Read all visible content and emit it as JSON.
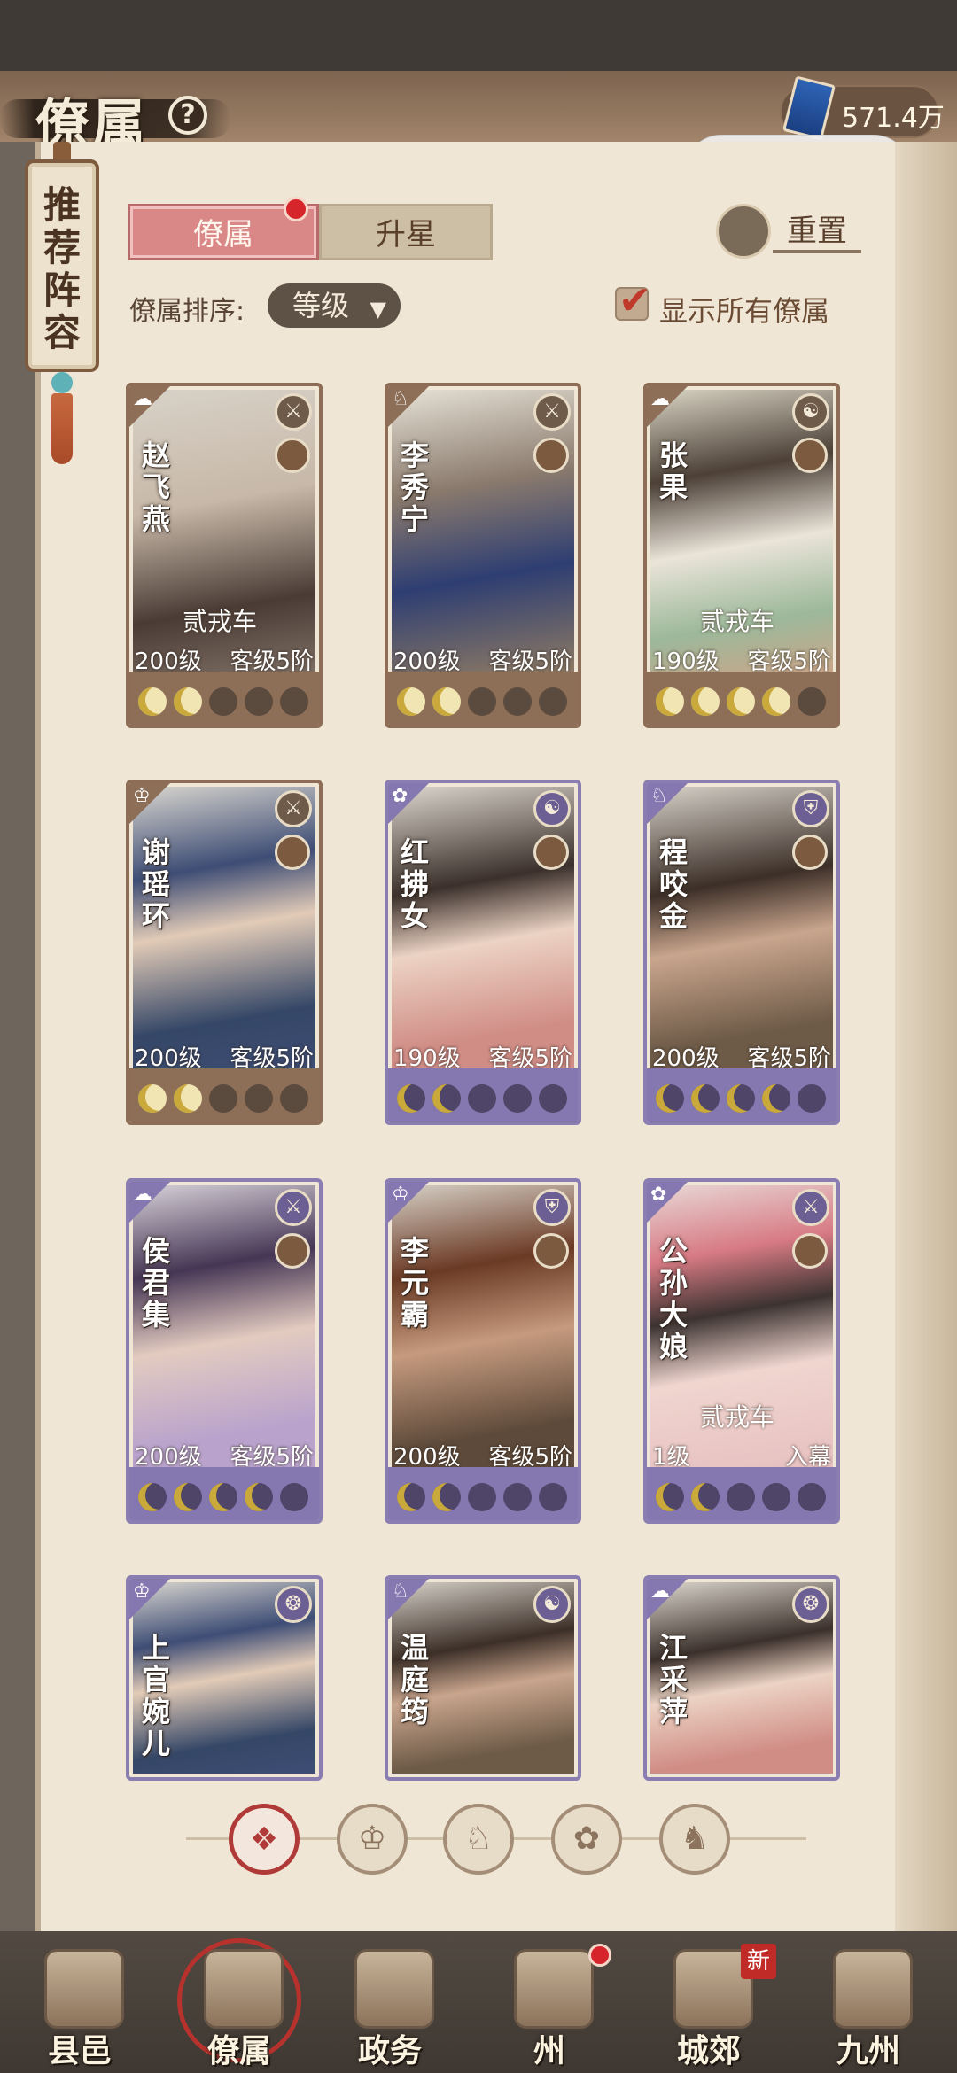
{
  "header": {
    "title": "僚属",
    "help_icon": "?",
    "currency_value": "571.4万",
    "capsule_more": "•••"
  },
  "lineup_banner": {
    "label": "推荐阵容"
  },
  "tabs": [
    {
      "label": "僚属",
      "active": true,
      "badge": true
    },
    {
      "label": "升星",
      "active": false
    }
  ],
  "reset_label": "重置",
  "sort": {
    "label": "僚属排序:",
    "value": "等级",
    "caret": "▼"
  },
  "show_all": {
    "label": "显示所有僚属",
    "checked": true,
    "check_glyph": "✔"
  },
  "cards": [
    {
      "name": "赵飞燕",
      "assignment": "贰戎车",
      "level": "200级",
      "rank": "客级5阶",
      "moons": 2,
      "attr": "⚔",
      "type_icon": "☁",
      "theme": "brown"
    },
    {
      "name": "李秀宁",
      "assignment": "",
      "level": "200级",
      "rank": "客级5阶",
      "moons": 2,
      "attr": "⚔",
      "type_icon": "♘",
      "theme": "brown"
    },
    {
      "name": "张果",
      "assignment": "贰戎车",
      "level": "190级",
      "rank": "客级5阶",
      "moons": 4,
      "attr": "☯",
      "type_icon": "☁",
      "theme": "brown"
    },
    {
      "name": "谢瑶环",
      "assignment": "",
      "level": "200级",
      "rank": "客级5阶",
      "moons": 2,
      "attr": "⚔",
      "type_icon": "♔",
      "theme": "brown"
    },
    {
      "name": "红拂女",
      "assignment": "",
      "level": "190级",
      "rank": "客级5阶",
      "moons": 2,
      "attr": "☯",
      "type_icon": "✿",
      "theme": "purple"
    },
    {
      "name": "程咬金",
      "assignment": "",
      "level": "200级",
      "rank": "客级5阶",
      "moons": 4,
      "attr": "⛨",
      "type_icon": "♘",
      "theme": "purple"
    },
    {
      "name": "侯君集",
      "assignment": "",
      "level": "200级",
      "rank": "客级5阶",
      "moons": 4,
      "attr": "⚔",
      "type_icon": "☁",
      "theme": "purple"
    },
    {
      "name": "李元霸",
      "assignment": "",
      "level": "200级",
      "rank": "客级5阶",
      "moons": 2,
      "attr": "⛨",
      "type_icon": "♔",
      "theme": "purple"
    },
    {
      "name": "公孙大娘",
      "assignment": "贰戎车",
      "level": "1级",
      "rank": "入幕",
      "moons": 2,
      "attr": "⚔",
      "type_icon": "✿",
      "theme": "purple"
    },
    {
      "name": "上官婉儿",
      "theme": "purple",
      "attr": "❂",
      "type_icon": "♔"
    },
    {
      "name": "温庭筠",
      "theme": "purple",
      "attr": "☯",
      "type_icon": "♘"
    },
    {
      "name": "江采萍",
      "theme": "purple",
      "attr": "❂",
      "type_icon": "☁"
    }
  ],
  "filters": [
    {
      "icon": "❖",
      "name": "filter-all",
      "active": true
    },
    {
      "icon": "♔",
      "name": "filter-civil"
    },
    {
      "icon": "♘",
      "name": "filter-military"
    },
    {
      "icon": "✿",
      "name": "filter-charm"
    },
    {
      "icon": "♞",
      "name": "filter-strategy"
    }
  ],
  "bottom_nav": [
    {
      "label": "县邑",
      "active": false
    },
    {
      "label": "僚属",
      "active": true
    },
    {
      "label": "政务",
      "active": false
    },
    {
      "label": "州",
      "active": false,
      "badge": "dot"
    },
    {
      "label": "城郊",
      "active": false,
      "badge": "新"
    },
    {
      "label": "九州",
      "active": false
    }
  ]
}
